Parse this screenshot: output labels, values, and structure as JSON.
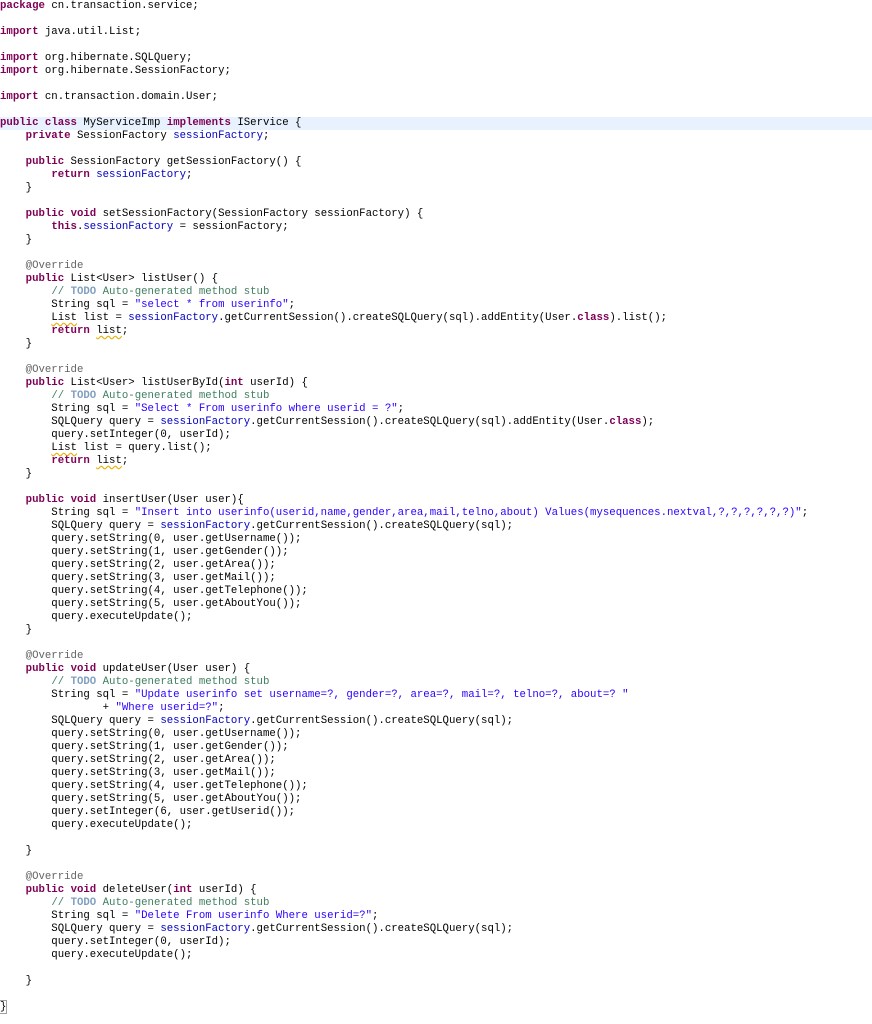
{
  "editor": {
    "colors": {
      "keyword": "#7f0055",
      "field": "#0000c0",
      "string": "#2a00ff",
      "comment": "#3f7f5f",
      "todo": "#7f9fbf",
      "annotation": "#646464",
      "current_line": "#e8f2fe"
    },
    "lines": [
      {
        "n": 1,
        "tokens": [
          {
            "t": "package",
            "c": "kw"
          },
          {
            "t": " cn.transaction.service;"
          }
        ]
      },
      {
        "n": 3,
        "tokens": [
          {
            "t": "import",
            "c": "kw"
          },
          {
            "t": " java.util.List;"
          }
        ]
      },
      {
        "n": 5,
        "tokens": [
          {
            "t": "import",
            "c": "kw"
          },
          {
            "t": " org.hibernate.SQLQuery;"
          }
        ]
      },
      {
        "n": 6,
        "tokens": [
          {
            "t": "import",
            "c": "kw"
          },
          {
            "t": " org.hibernate.SessionFactory;"
          }
        ]
      },
      {
        "n": 8,
        "tokens": [
          {
            "t": "import",
            "c": "kw"
          },
          {
            "t": " cn.transaction.domain.User;"
          }
        ]
      },
      {
        "n": 10,
        "current": true,
        "tokens": [
          {
            "t": "public",
            "c": "kw"
          },
          {
            "t": " "
          },
          {
            "t": "class",
            "c": "kw"
          },
          {
            "t": " MyServiceImp "
          },
          {
            "t": "implements",
            "c": "kw"
          },
          {
            "t": " IService {"
          }
        ]
      },
      {
        "n": 11,
        "tokens": [
          {
            "t": "    "
          },
          {
            "t": "private",
            "c": "kw"
          },
          {
            "t": " SessionFactory "
          },
          {
            "t": "sessionFactory",
            "c": "field"
          },
          {
            "t": ";"
          }
        ]
      },
      {
        "n": 13,
        "tokens": [
          {
            "t": "    "
          },
          {
            "t": "public",
            "c": "kw"
          },
          {
            "t": " SessionFactory getSessionFactory() {"
          }
        ]
      },
      {
        "n": 14,
        "tokens": [
          {
            "t": "        "
          },
          {
            "t": "return",
            "c": "kw"
          },
          {
            "t": " "
          },
          {
            "t": "sessionFactory",
            "c": "field"
          },
          {
            "t": ";"
          }
        ]
      },
      {
        "n": 15,
        "tokens": [
          {
            "t": "    }"
          }
        ]
      },
      {
        "n": 17,
        "tokens": [
          {
            "t": "    "
          },
          {
            "t": "public",
            "c": "kw"
          },
          {
            "t": " "
          },
          {
            "t": "void",
            "c": "kw"
          },
          {
            "t": " setSessionFactory(SessionFactory sessionFactory) {"
          }
        ]
      },
      {
        "n": 18,
        "tokens": [
          {
            "t": "        "
          },
          {
            "t": "this",
            "c": "kw"
          },
          {
            "t": "."
          },
          {
            "t": "sessionFactory",
            "c": "field"
          },
          {
            "t": " = sessionFactory;"
          }
        ]
      },
      {
        "n": 19,
        "tokens": [
          {
            "t": "    }"
          }
        ]
      },
      {
        "n": 21,
        "tokens": [
          {
            "t": "    "
          },
          {
            "t": "@Override",
            "c": "ann"
          }
        ]
      },
      {
        "n": 22,
        "tokens": [
          {
            "t": "    "
          },
          {
            "t": "public",
            "c": "kw"
          },
          {
            "t": " List<User> listUser() {"
          }
        ]
      },
      {
        "n": 23,
        "tokens": [
          {
            "t": "        "
          },
          {
            "t": "// ",
            "c": "comment"
          },
          {
            "t": "TODO",
            "c": "todo"
          },
          {
            "t": " Auto-generated method stub",
            "c": "comment"
          }
        ]
      },
      {
        "n": 24,
        "tokens": [
          {
            "t": "        String sql = "
          },
          {
            "t": "\"select * from userinfo\"",
            "c": "str"
          },
          {
            "t": ";"
          }
        ]
      },
      {
        "n": 25,
        "tokens": [
          {
            "t": "        "
          },
          {
            "t": "List",
            "c": "warn"
          },
          {
            "t": " list = "
          },
          {
            "t": "sessionFactory",
            "c": "field"
          },
          {
            "t": ".getCurrentSession().createSQLQuery(sql).addEntity(User."
          },
          {
            "t": "class",
            "c": "kw"
          },
          {
            "t": ").list();"
          }
        ]
      },
      {
        "n": 26,
        "tokens": [
          {
            "t": "        "
          },
          {
            "t": "return",
            "c": "kw"
          },
          {
            "t": " "
          },
          {
            "t": "list",
            "c": "warn"
          },
          {
            "t": ";"
          }
        ]
      },
      {
        "n": 27,
        "tokens": [
          {
            "t": "    }"
          }
        ]
      },
      {
        "n": 29,
        "tokens": [
          {
            "t": "    "
          },
          {
            "t": "@Override",
            "c": "ann"
          }
        ]
      },
      {
        "n": 30,
        "tokens": [
          {
            "t": "    "
          },
          {
            "t": "public",
            "c": "kw"
          },
          {
            "t": " List<User> listUserById("
          },
          {
            "t": "int",
            "c": "kw"
          },
          {
            "t": " userId) {"
          }
        ]
      },
      {
        "n": 31,
        "tokens": [
          {
            "t": "        "
          },
          {
            "t": "// ",
            "c": "comment"
          },
          {
            "t": "TODO",
            "c": "todo"
          },
          {
            "t": " Auto-generated method stub",
            "c": "comment"
          }
        ]
      },
      {
        "n": 32,
        "tokens": [
          {
            "t": "        String sql = "
          },
          {
            "t": "\"Select * From userinfo where userid = ?\"",
            "c": "str"
          },
          {
            "t": ";"
          }
        ]
      },
      {
        "n": 33,
        "tokens": [
          {
            "t": "        SQLQuery query = "
          },
          {
            "t": "sessionFactory",
            "c": "field"
          },
          {
            "t": ".getCurrentSession().createSQLQuery(sql).addEntity(User."
          },
          {
            "t": "class",
            "c": "kw"
          },
          {
            "t": ");"
          }
        ]
      },
      {
        "n": 34,
        "tokens": [
          {
            "t": "        query.setInteger(0, userId);"
          }
        ]
      },
      {
        "n": 35,
        "tokens": [
          {
            "t": "        "
          },
          {
            "t": "List",
            "c": "warn"
          },
          {
            "t": " list = query.list();"
          }
        ]
      },
      {
        "n": 36,
        "tokens": [
          {
            "t": "        "
          },
          {
            "t": "return",
            "c": "kw"
          },
          {
            "t": " "
          },
          {
            "t": "list",
            "c": "warn"
          },
          {
            "t": ";"
          }
        ]
      },
      {
        "n": 37,
        "tokens": [
          {
            "t": "    }"
          }
        ]
      },
      {
        "n": 39,
        "tokens": [
          {
            "t": "    "
          },
          {
            "t": "public",
            "c": "kw"
          },
          {
            "t": " "
          },
          {
            "t": "void",
            "c": "kw"
          },
          {
            "t": " insertUser(User user){"
          }
        ]
      },
      {
        "n": 40,
        "tokens": [
          {
            "t": "        String sql = "
          },
          {
            "t": "\"Insert into userinfo(userid,name,gender,area,mail,telno,about) Values(mysequences.nextval,?,?,?,?,?,?)\"",
            "c": "str"
          },
          {
            "t": ";"
          }
        ]
      },
      {
        "n": 41,
        "tokens": [
          {
            "t": "        SQLQuery query = "
          },
          {
            "t": "sessionFactory",
            "c": "field"
          },
          {
            "t": ".getCurrentSession().createSQLQuery(sql);"
          }
        ]
      },
      {
        "n": 42,
        "tokens": [
          {
            "t": "        query.setString(0, user.getUsername());"
          }
        ]
      },
      {
        "n": 43,
        "tokens": [
          {
            "t": "        query.setString(1, user.getGender());"
          }
        ]
      },
      {
        "n": 44,
        "tokens": [
          {
            "t": "        query.setString(2, user.getArea());"
          }
        ]
      },
      {
        "n": 45,
        "tokens": [
          {
            "t": "        query.setString(3, user.getMail());"
          }
        ]
      },
      {
        "n": 46,
        "tokens": [
          {
            "t": "        query.setString(4, user.getTelephone());"
          }
        ]
      },
      {
        "n": 47,
        "tokens": [
          {
            "t": "        query.setString(5, user.getAboutYou());"
          }
        ]
      },
      {
        "n": 48,
        "tokens": [
          {
            "t": "        query.executeUpdate();"
          }
        ]
      },
      {
        "n": 49,
        "tokens": [
          {
            "t": "    }"
          }
        ]
      },
      {
        "n": 51,
        "tokens": [
          {
            "t": "    "
          },
          {
            "t": "@Override",
            "c": "ann"
          }
        ]
      },
      {
        "n": 52,
        "tokens": [
          {
            "t": "    "
          },
          {
            "t": "public",
            "c": "kw"
          },
          {
            "t": " "
          },
          {
            "t": "void",
            "c": "kw"
          },
          {
            "t": " updateUser(User user) {"
          }
        ]
      },
      {
        "n": 53,
        "tokens": [
          {
            "t": "        "
          },
          {
            "t": "// ",
            "c": "comment"
          },
          {
            "t": "TODO",
            "c": "todo"
          },
          {
            "t": " Auto-generated method stub",
            "c": "comment"
          }
        ]
      },
      {
        "n": 54,
        "tokens": [
          {
            "t": "        String sql = "
          },
          {
            "t": "\"Update userinfo set username=?, gender=?, area=?, mail=?, telno=?, about=? \"",
            "c": "str"
          }
        ]
      },
      {
        "n": 55,
        "tokens": [
          {
            "t": "                + "
          },
          {
            "t": "\"Where userid=?\"",
            "c": "str"
          },
          {
            "t": ";"
          }
        ]
      },
      {
        "n": 56,
        "tokens": [
          {
            "t": "        SQLQuery query = "
          },
          {
            "t": "sessionFactory",
            "c": "field"
          },
          {
            "t": ".getCurrentSession().createSQLQuery(sql);"
          }
        ]
      },
      {
        "n": 57,
        "tokens": [
          {
            "t": "        query.setString(0, user.getUsername());"
          }
        ]
      },
      {
        "n": 58,
        "tokens": [
          {
            "t": "        query.setString(1, user.getGender());"
          }
        ]
      },
      {
        "n": 59,
        "tokens": [
          {
            "t": "        query.setString(2, user.getArea());"
          }
        ]
      },
      {
        "n": 60,
        "tokens": [
          {
            "t": "        query.setString(3, user.getMail());"
          }
        ]
      },
      {
        "n": 61,
        "tokens": [
          {
            "t": "        query.setString(4, user.getTelephone());"
          }
        ]
      },
      {
        "n": 62,
        "tokens": [
          {
            "t": "        query.setString(5, user.getAboutYou());"
          }
        ]
      },
      {
        "n": 63,
        "tokens": [
          {
            "t": "        query.setInteger(6, user.getUserid());"
          }
        ]
      },
      {
        "n": 64,
        "tokens": [
          {
            "t": "        query.executeUpdate();"
          }
        ]
      },
      {
        "n": 66,
        "tokens": [
          {
            "t": "    }"
          }
        ]
      },
      {
        "n": 68,
        "tokens": [
          {
            "t": "    "
          },
          {
            "t": "@Override",
            "c": "ann"
          }
        ]
      },
      {
        "n": 69,
        "tokens": [
          {
            "t": "    "
          },
          {
            "t": "public",
            "c": "kw"
          },
          {
            "t": " "
          },
          {
            "t": "void",
            "c": "kw"
          },
          {
            "t": " deleteUser("
          },
          {
            "t": "int",
            "c": "kw"
          },
          {
            "t": " userId) {"
          }
        ]
      },
      {
        "n": 70,
        "tokens": [
          {
            "t": "        "
          },
          {
            "t": "// ",
            "c": "comment"
          },
          {
            "t": "TODO",
            "c": "todo"
          },
          {
            "t": " Auto-generated method stub",
            "c": "comment"
          }
        ]
      },
      {
        "n": 71,
        "tokens": [
          {
            "t": "        String sql = "
          },
          {
            "t": "\"Delete From userinfo Where userid=?\"",
            "c": "str"
          },
          {
            "t": ";"
          }
        ]
      },
      {
        "n": 72,
        "tokens": [
          {
            "t": "        SQLQuery query = "
          },
          {
            "t": "sessionFactory",
            "c": "field"
          },
          {
            "t": ".getCurrentSession().createSQLQuery(sql);"
          }
        ]
      },
      {
        "n": 73,
        "tokens": [
          {
            "t": "        query.setInteger(0, userId);"
          }
        ]
      },
      {
        "n": 74,
        "tokens": [
          {
            "t": "        query.executeUpdate();"
          }
        ]
      },
      {
        "n": 76,
        "tokens": [
          {
            "t": "    }"
          }
        ]
      },
      {
        "n": 78,
        "tokens": [
          {
            "t": "}",
            "c": "bracket"
          }
        ]
      }
    ]
  }
}
